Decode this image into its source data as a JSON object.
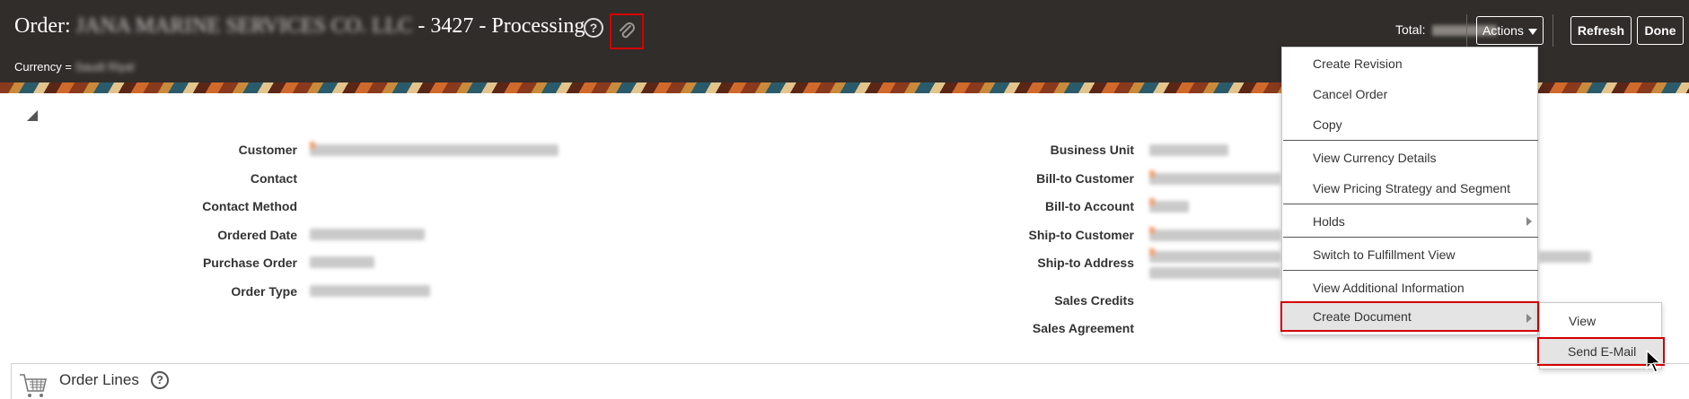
{
  "header": {
    "order_prefix": "Order:",
    "customer_name": "JANA MARINE SERVICES CO. LLC",
    "order_suffix": "- 3427 - Processing",
    "help_glyph": "?",
    "currency_label": "Currency =",
    "currency_value": "Saudi Riyal",
    "total_label": "Total:",
    "actions_label": "Actions",
    "refresh_label": "Refresh",
    "done_label": "Done"
  },
  "fields_left": {
    "labels": [
      "Customer",
      "Contact",
      "Contact Method",
      "Ordered Date",
      "Purchase Order",
      "Order Type"
    ]
  },
  "fields_right": {
    "labels": [
      "Business Unit",
      "Bill-to Customer",
      "Bill-to Account",
      "Ship-to Customer",
      "Ship-to Address",
      "Sales Credits",
      "Sales Agreement"
    ]
  },
  "actions_menu": {
    "items": [
      "Create Revision",
      "Cancel Order",
      "Copy",
      "View Currency Details",
      "View Pricing Strategy and Segment",
      "Holds",
      "Switch to Fulfillment View",
      "View Additional Information",
      "Create Document"
    ],
    "highlighted": "Create Document"
  },
  "create_document_submenu": {
    "items": [
      "View",
      "Send E-Mail"
    ],
    "highlighted": "Send E-Mail"
  },
  "order_lines": {
    "title": "Order Lines",
    "help_glyph": "?"
  },
  "colors": {
    "header_bg": "#312d2a",
    "highlight_border": "#d40000",
    "menu_highlight_bg": "#e4e4e4"
  },
  "icons": [
    "help-icon",
    "attachment-icon",
    "dropdown-arrow-icon",
    "collapse-triangle-icon",
    "submenu-arrow-icon",
    "cursor-icon",
    "cart-icon"
  ]
}
